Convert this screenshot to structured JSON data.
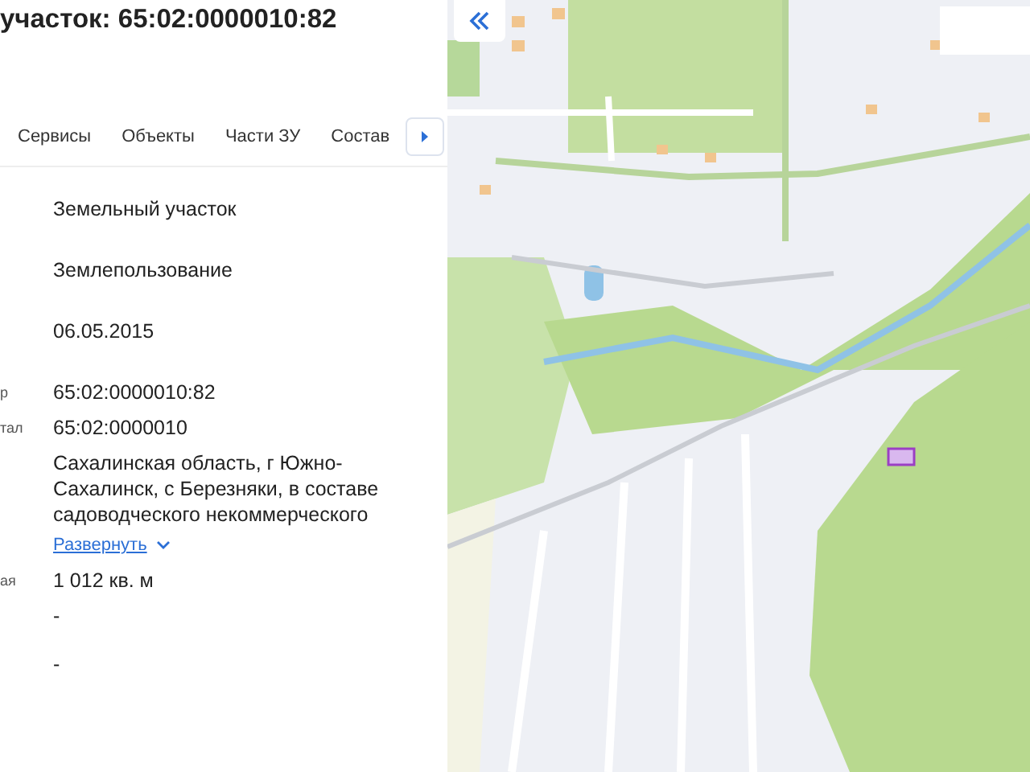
{
  "panel": {
    "title": "участок: 65:02:0000010:82",
    "tabs": [
      {
        "label": "Сервисы",
        "selected": false
      },
      {
        "label": "Объекты",
        "selected": false
      },
      {
        "label": "Части ЗУ",
        "selected": false
      },
      {
        "label": "Состав",
        "selected": false
      }
    ],
    "rows": [
      {
        "label": "",
        "value": "Земельный участок"
      },
      {
        "label": "",
        "value": "Землепользование"
      },
      {
        "label": "",
        "value": "06.05.2015"
      },
      {
        "label": "р",
        "value": "65:02:0000010:82"
      },
      {
        "label": "тал",
        "value": "65:02:0000010"
      },
      {
        "label": "",
        "value": "Сахалинская область, г Южно-Сахалинск, с Березняки, в составе садоводческого некоммерческого",
        "expand": "Развернуть"
      },
      {
        "label": "ая",
        "value": "1 012 кв. м"
      },
      {
        "label": "",
        "value": "-"
      },
      {
        "label": "",
        "value": "-"
      }
    ]
  }
}
